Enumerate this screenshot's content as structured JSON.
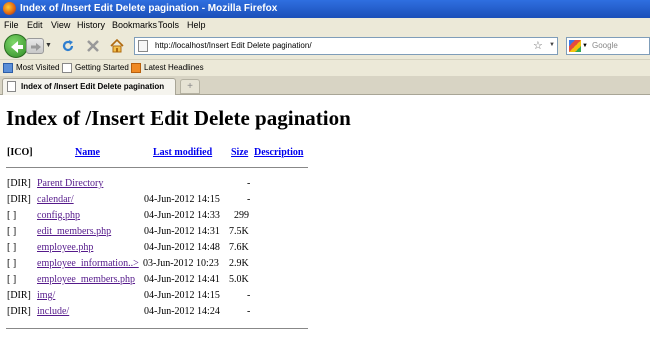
{
  "window": {
    "title": "Index of /Insert Edit Delete pagination - Mozilla Firefox"
  },
  "menu": [
    "File",
    "Edit",
    "View",
    "History",
    "Bookmarks",
    "Tools",
    "Help"
  ],
  "address_bar": {
    "url": "http://localhost/Insert Edit Delete pagination/"
  },
  "search_bar": {
    "placeholder": "Google"
  },
  "bookmarks": [
    "Most Visited",
    "Getting Started",
    "Latest Headlines"
  ],
  "tabs": [
    {
      "label": "Index of /Insert Edit Delete pagination"
    }
  ],
  "page": {
    "heading": "Index of /Insert Edit Delete pagination",
    "columns": {
      "icon": "[ICO]",
      "name": "Name",
      "modified": "Last modified",
      "size": "Size",
      "description": "Description"
    },
    "rows": [
      {
        "icon": "[DIR]",
        "name": "Parent Directory",
        "modified": "",
        "size": "-"
      },
      {
        "icon": "[DIR]",
        "name": "calendar/",
        "modified": "04-Jun-2012 14:15",
        "size": "-"
      },
      {
        "icon": "[ ]",
        "name": "config.php",
        "modified": "04-Jun-2012 14:33",
        "size": "299"
      },
      {
        "icon": "[ ]",
        "name": "edit_members.php",
        "modified": "04-Jun-2012 14:31",
        "size": "7.5K"
      },
      {
        "icon": "[ ]",
        "name": "employee.php",
        "modified": "04-Jun-2012 14:48",
        "size": "7.6K"
      },
      {
        "icon": "[ ]",
        "name": "employee_information..>",
        "modified": "03-Jun-2012 10:23",
        "size": "2.9K"
      },
      {
        "icon": "[ ]",
        "name": "employee_members.php",
        "modified": "04-Jun-2012 14:41",
        "size": "5.0K"
      },
      {
        "icon": "[DIR]",
        "name": "img/",
        "modified": "04-Jun-2012 14:15",
        "size": "-"
      },
      {
        "icon": "[DIR]",
        "name": "include/",
        "modified": "04-Jun-2012 14:24",
        "size": "-"
      }
    ]
  }
}
